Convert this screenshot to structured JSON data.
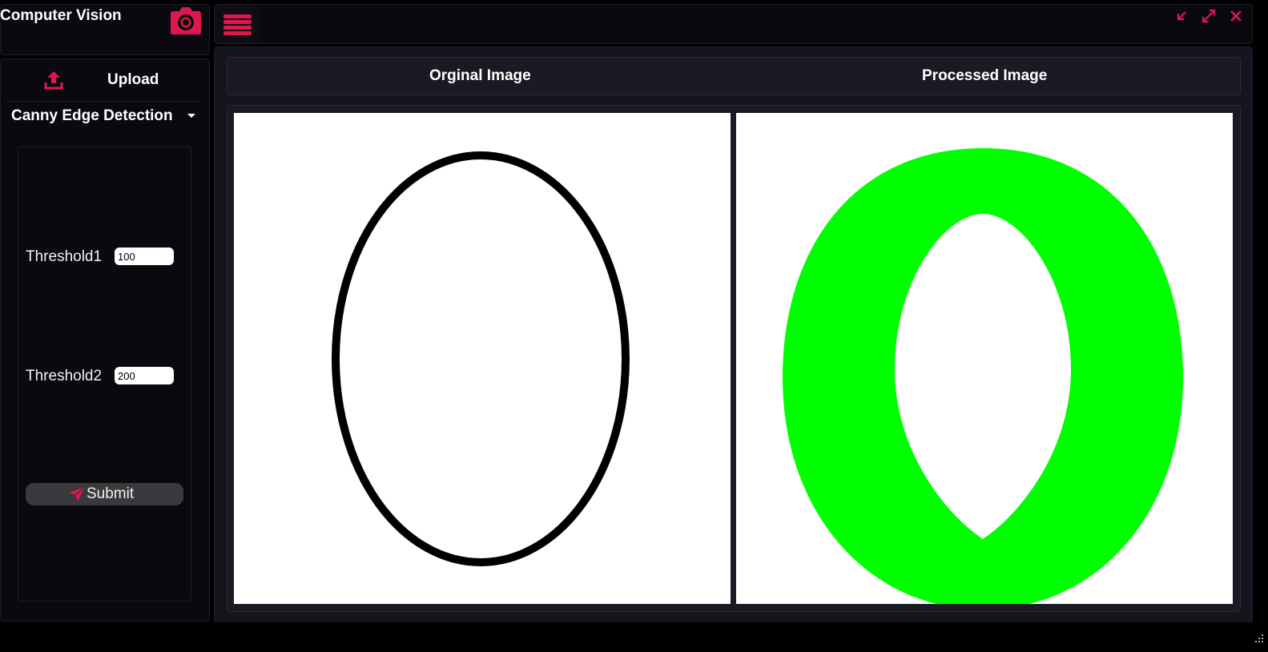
{
  "app": {
    "title": "Computer Vision",
    "logo_icon": "camera-icon",
    "accent_color": "#e0164f"
  },
  "sidebar": {
    "upload": {
      "icon": "upload-icon",
      "label": "Upload"
    },
    "filter_select": {
      "selected": "Canny Edge Detection",
      "icon": "caret-down-icon"
    },
    "params": [
      {
        "label": "Threshold1",
        "value": "100"
      },
      {
        "label": "Threshold2",
        "value": "200"
      }
    ],
    "submit": {
      "icon": "send-icon",
      "label": "Submit"
    }
  },
  "toolbar": {
    "menu_icon": "hamburger-menu-icon",
    "window_buttons": [
      "minimize-icon",
      "maximize-icon",
      "close-icon"
    ]
  },
  "main": {
    "original_header": "Orginal Image",
    "processed_header": "Processed Image",
    "original_image": {
      "content": "black ellipse outline on white"
    },
    "processed_image": {
      "content": "green thick ellipse ring on white"
    },
    "processed_color": "#00ff00"
  }
}
